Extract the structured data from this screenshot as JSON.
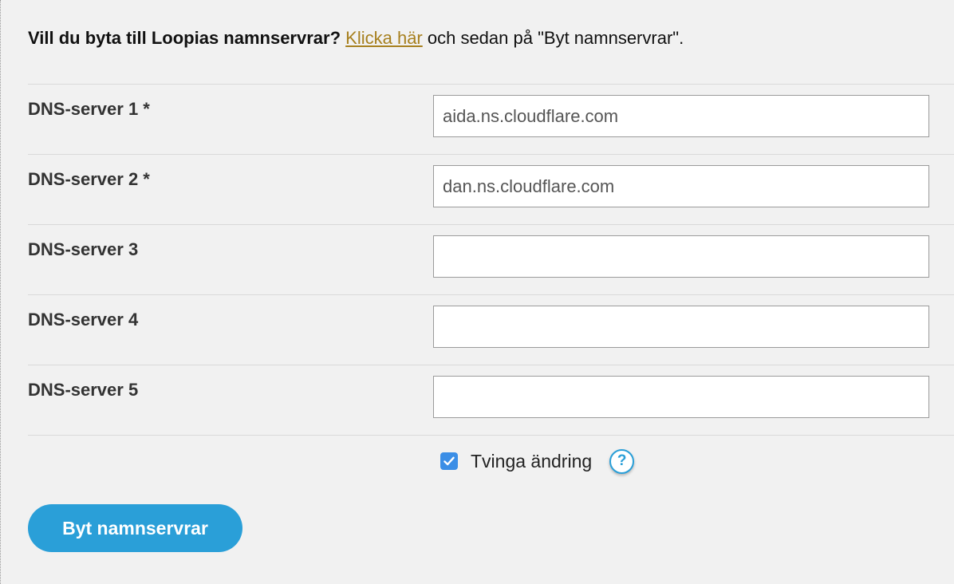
{
  "intro": {
    "question": "Vill du byta till Loopias namnservrar?",
    "link_text": "Klicka här",
    "rest": " och sedan på \"Byt namnservrar\"."
  },
  "dns_rows": [
    {
      "label": "DNS-server 1 *",
      "value": "aida.ns.cloudflare.com"
    },
    {
      "label": "DNS-server 2 *",
      "value": "dan.ns.cloudflare.com"
    },
    {
      "label": "DNS-server 3",
      "value": ""
    },
    {
      "label": "DNS-server 4",
      "value": ""
    },
    {
      "label": "DNS-server 5",
      "value": ""
    }
  ],
  "force_change": {
    "label": "Tvinga ändring",
    "checked": true,
    "help_symbol": "?"
  },
  "submit_label": "Byt namnservrar",
  "colors": {
    "background": "#f1f1f1",
    "link": "#a7801f",
    "accent": "#2a9fd8",
    "checkbox": "#3b8ee6"
  },
  "icons": {
    "checkbox": "checkmark-icon",
    "help": "question-mark-icon"
  }
}
